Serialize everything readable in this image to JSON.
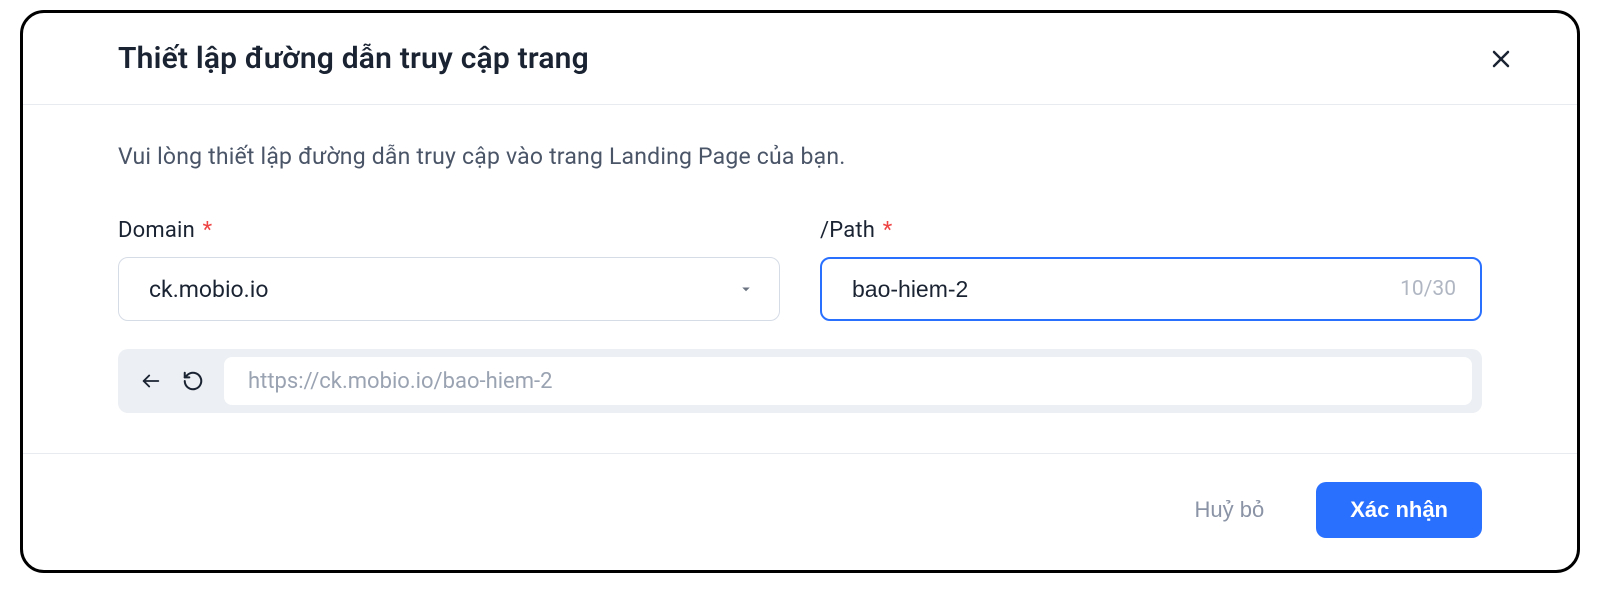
{
  "modal": {
    "title": "Thiết lập đường dẫn truy cập trang",
    "description": "Vui lòng thiết lập đường dẫn truy cập vào trang Landing Page của bạn."
  },
  "fields": {
    "domain": {
      "label": "Domain",
      "value": "ck.mobio.io"
    },
    "path": {
      "label": "/Path",
      "value": "bao-hiem-2",
      "char_count": "10/30"
    }
  },
  "preview": {
    "url": "https://ck.mobio.io/bao-hiem-2"
  },
  "footer": {
    "cancel_label": "Huỷ bỏ",
    "confirm_label": "Xác nhận"
  }
}
